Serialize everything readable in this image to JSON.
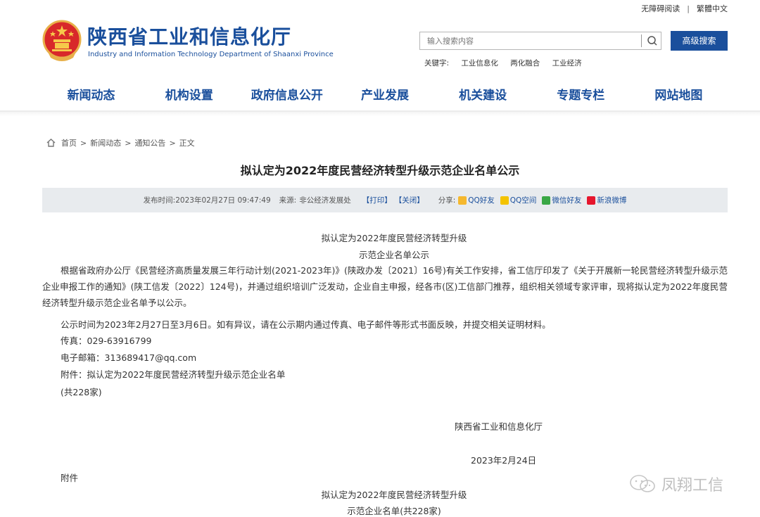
{
  "util": {
    "accessibility": "无障碍阅读",
    "traditional": "繁體中文"
  },
  "site": {
    "name_cn": "陕西省工业和信息化厅",
    "name_en": "Industry and Information Technology Department of Shaanxi Province"
  },
  "search": {
    "placeholder": "输入搜索内容",
    "advanced_label": "高级搜索",
    "keywords_label": "关键字:",
    "keywords": [
      "工业信息化",
      "两化融合",
      "工业经济"
    ]
  },
  "nav": [
    "新闻动态",
    "机构设置",
    "政府信息公开",
    "产业发展",
    "机关建设",
    "专题专栏",
    "网站地图"
  ],
  "breadcrumb": [
    "首页",
    "新闻动态",
    "通知公告",
    "正文"
  ],
  "article": {
    "title": "拟认定为2022年度民营经济转型升级示范企业名单公示",
    "meta": {
      "publish_label": "发布时间:",
      "publish_time": "2023年02月27日 09:47:49",
      "source_label": "来源:",
      "source": "非公经济发展处",
      "print": "【打印】",
      "close": "【关闭】",
      "share_label": "分享:",
      "share": [
        "QQ好友",
        "QQ空间",
        "微信好友",
        "新浪微博"
      ]
    },
    "heading1": "拟认定为2022年度民营经济转型升级",
    "heading2": "示范企业名单公示",
    "paragraph": "根据省政府办公厅《民营经济高质量发展三年行动计划(2021-2023年)》(陕政办发〔2021〕16号)有关工作安排，省工信厅印发了《关于开展新一轮民营经济转型升级示范企业申报工作的通知》(陕工信发〔2022〕124号)，并通过组织培训广泛发动，企业自主申报，经各市(区)工信部门推荐，组织相关领域专家评审，现将拟认定为2022年度民营经济转型升级示范企业名单予以公示。",
    "notice": "公示时间为2023年2月27日至3月6日。如有异议，请在公示期内通过传真、电子邮件等形式书面反映，并提交相关证明材料。",
    "fax": "传真：029-63916799",
    "email": "电子邮箱：313689417@qq.com",
    "attachment": "附件：拟认定为2022年度民营经济转型升级示范企业名单",
    "count": "(共228家)",
    "signature": "陕西省工业和信息化厅",
    "date": "2023年2月24日",
    "appendix_label": "附件",
    "appendix_h1": "拟认定为2022年度民营经济转型升级",
    "appendix_h2": "示范企业名单(共228家)"
  },
  "watermark": "凤翔工信",
  "colors": {
    "brand": "#1a4f9c",
    "meta_bg": "#e8ebee"
  }
}
